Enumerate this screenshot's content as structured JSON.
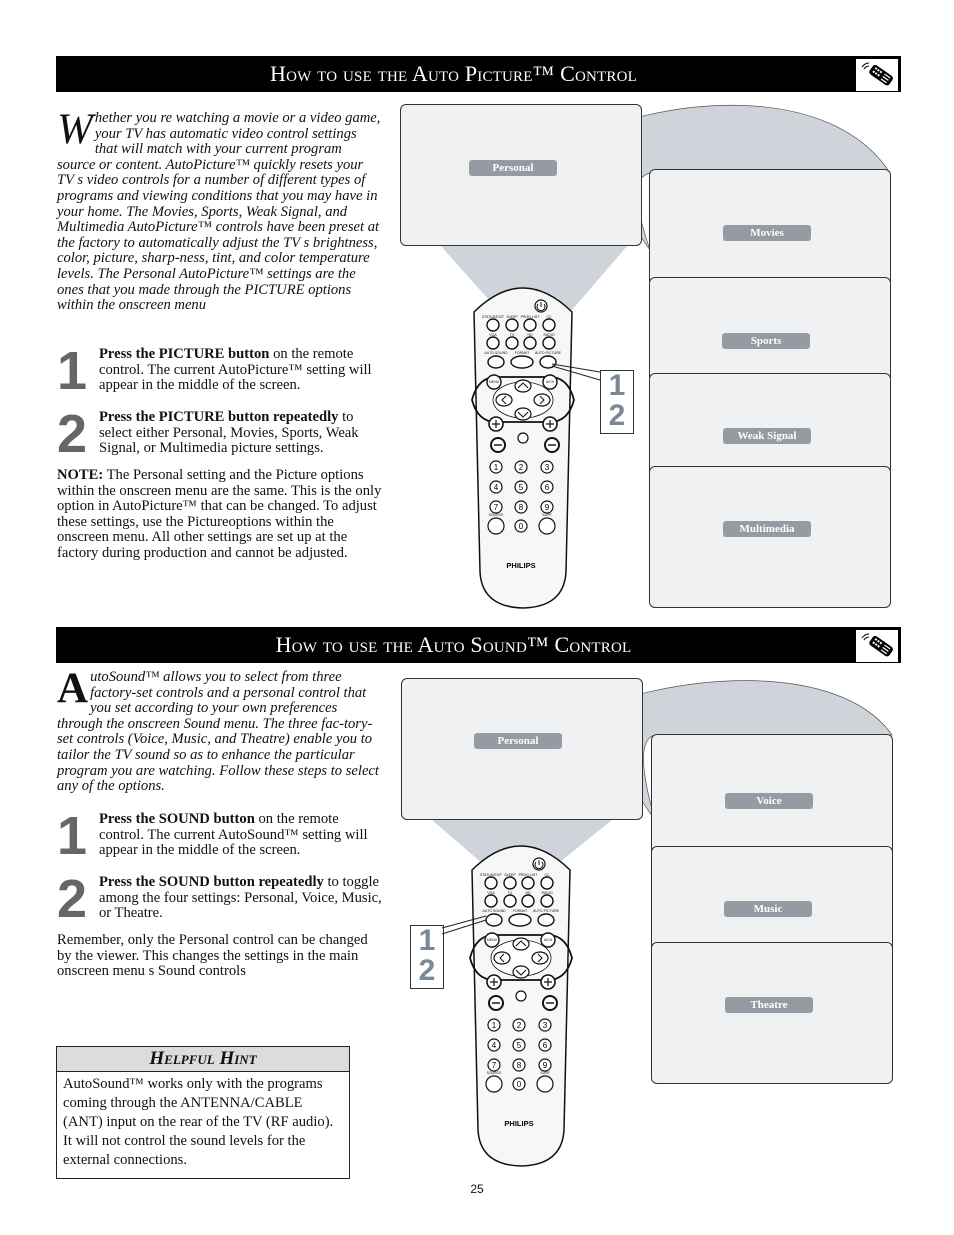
{
  "page_number": "25",
  "sections": [
    {
      "title": "How to use the Auto Picture™ Control",
      "intro_dropcap": "W",
      "intro": "hether you re watching a movie or a video game, your TV has automatic video control settings that will match with your current program source or content.  AutoPicture™ quickly resets your TV s video controls for a number of different types of programs and viewing conditions that you may have in your home.  The Movies, Sports, Weak Signal, and Multimedia AutoPicture™ controls have been preset at the factory to automatically adjust the TV s brightness, color, picture, sharp-ness, tint, and color temperature levels.  The Personal AutoPicture™ settings are the ones that you made through the PICTURE options within the onscreen menu",
      "steps": [
        {
          "number": "1",
          "bold": "Press the PICTURE button",
          "text": " on the remote control.  The current AutoPicture™ setting will appear in the middle of the screen."
        },
        {
          "number": "2",
          "bold": "Press the PICTURE button repeatedly",
          "text": " to select either Personal, Movies, Sports, Weak Signal, or Multimedia picture settings."
        }
      ],
      "note_label": "NOTE:",
      "note": "  The Personal setting and the Picture options within the onscreen menu are the same.  This is the only option in AutoPicture™ that can be changed. To adjust these settings, use the Pictureoptions within the onscreen menu. All other settings are set up at the factory during production and cannot be adjusted.",
      "screens": [
        "Personal",
        "Movies",
        "Sports",
        "Weak Signal",
        "Multimedia"
      ],
      "callout": [
        "1",
        "2"
      ]
    },
    {
      "title": "How to use the Auto Sound™ Control",
      "intro_dropcap": "A",
      "intro": "utoSound™ allows you to select from three factory-set controls and a personal control that you set according to your own preferences through the onscreen Sound menu. The three fac-tory-set controls (Voice, Music, and Theatre) enable you to tailor the TV sound so as to enhance the particular program you are watching. Follow these steps to select any of the options.",
      "steps": [
        {
          "number": "1",
          "bold": "Press the SOUND button",
          "text": " on the remote control.  The current AutoSound™ setting will appear in the middle of the screen."
        },
        {
          "number": "2",
          "bold": "Press the SOUND button repeatedly",
          "text": " to toggle among the four settings:  Personal, Voice, Music, or Theatre."
        }
      ],
      "note": "Remember, only the Personal control can be changed by the viewer.  This changes the settings in the main onscreen menu s Sound controls",
      "screens": [
        "Personal",
        "Voice",
        "Music",
        "Theatre"
      ],
      "callout": [
        "1",
        "2"
      ]
    }
  ],
  "hint": {
    "title": "Helpful Hint",
    "text": "AutoSound™ works only with the programs coming through the ANTENNA/CABLE (ANT) input on the rear of the TV (RF audio).  It will not control the sound levels for the external connections."
  },
  "remote": {
    "brand": "PHILIPS",
    "row1_labels": [
      "STATUS/EXIT",
      "SLEEP",
      "PROG.LIST",
      "CC"
    ],
    "row2_labels": [
      "VGA",
      "TV",
      "HD",
      "RADIO"
    ],
    "row3_labels": [
      "AUTO SOUND",
      "FORMAT",
      "AUTO PICTURE"
    ],
    "nav_labels": [
      "MENU",
      "A/CH"
    ],
    "digits": [
      "1",
      "2",
      "3",
      "4",
      "5",
      "6",
      "7",
      "8",
      "9",
      "0"
    ],
    "bottom_labels": [
      "SOURCE",
      "SURF"
    ]
  },
  "colors": {
    "header_bg": "#000000",
    "screen_bg": "#f0f1f3",
    "pill_bg": "#969ba3",
    "beam": "#cfd3da",
    "step_number": "#666666",
    "callout_number": "#7b8898"
  }
}
